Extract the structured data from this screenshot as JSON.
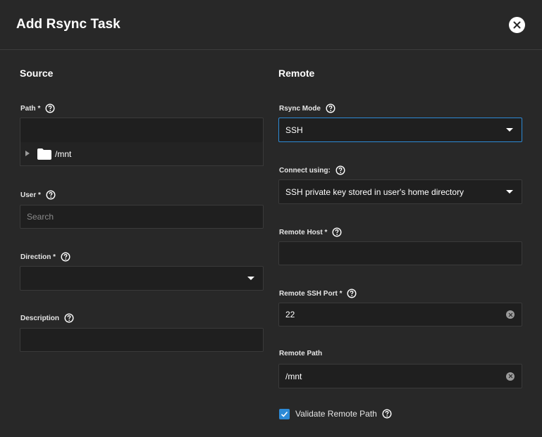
{
  "dialog": {
    "title": "Add Rsync Task",
    "close_icon": "close-icon"
  },
  "source": {
    "heading": "Source",
    "path": {
      "label": "Path *",
      "value": "",
      "tree_item": "/mnt"
    },
    "user": {
      "label": "User *",
      "placeholder": "Search"
    },
    "direction": {
      "label": "Direction *",
      "value": ""
    },
    "description": {
      "label": "Description",
      "value": ""
    }
  },
  "remote": {
    "heading": "Remote",
    "rsync_mode": {
      "label": "Rsync Mode",
      "value": "SSH"
    },
    "connect_using": {
      "label": "Connect using:",
      "value": "SSH private key stored in user's home directory"
    },
    "remote_host": {
      "label": "Remote Host *",
      "value": ""
    },
    "remote_ssh_port": {
      "label": "Remote SSH Port *",
      "value": "22"
    },
    "remote_path": {
      "label": "Remote Path",
      "value": "/mnt"
    },
    "validate_remote_path": {
      "label": "Validate Remote Path",
      "checked": true
    }
  },
  "colors": {
    "background": "#282828",
    "field": "#1f1f1f",
    "accent": "#2d8ad6"
  }
}
